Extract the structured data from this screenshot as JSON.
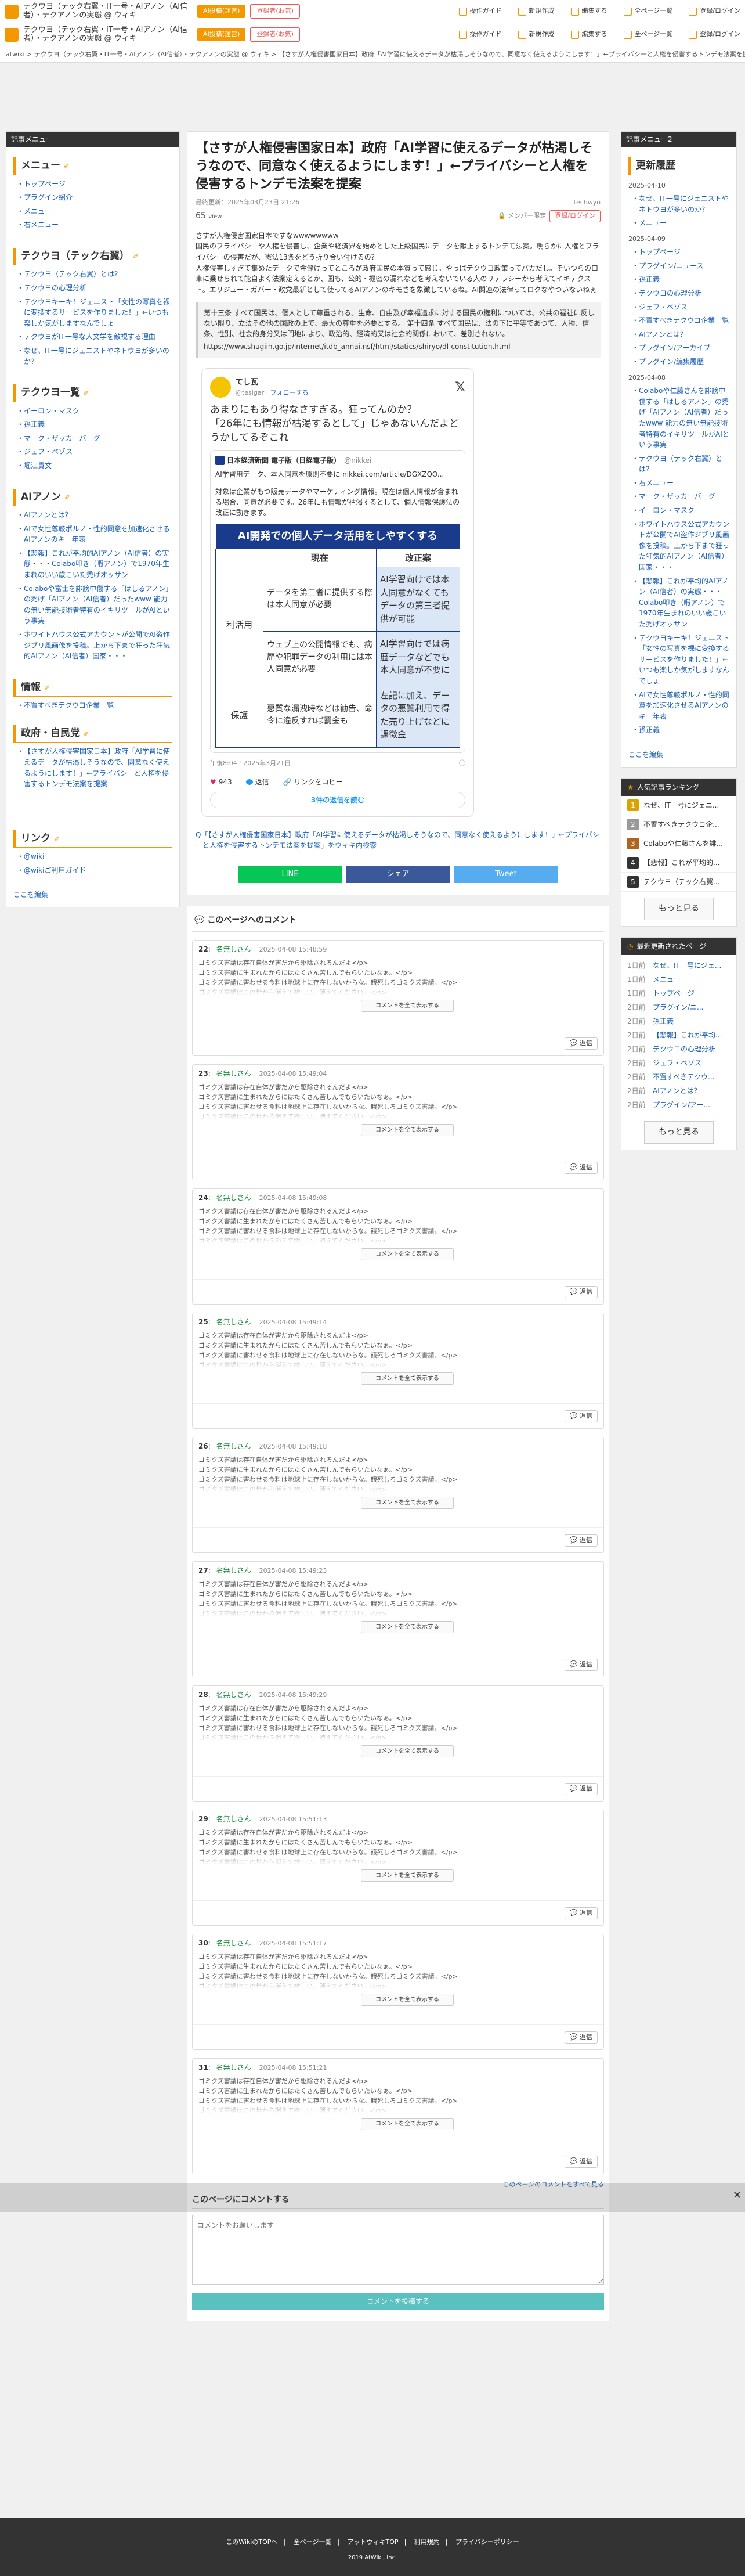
{
  "topbar": {
    "title": "テクウヨ（テック右翼・IT一号・AIアノン（AI信者）・テクアノンの実態 @ ウィキ",
    "btn_ai": "AI投稿(運営)",
    "btn_fav": "登録者(お気)",
    "nav": [
      "操作ガイド",
      "新規作成",
      "編集する",
      "全ページ一覧",
      "登録/ログイン"
    ]
  },
  "breadcrumb": "atwiki > テクウヨ（テック右翼・IT一号・AIアノン（AI信者）・テクアノンの実態 @ ウィキ > 【さすが人権侵害国家日本】政府「AI学習に使えるデータが枯渇しそうなので、同意なく使えるようにします！」←プライバシーと人権を侵害するトンデモ法案を提案",
  "left": {
    "header": "記事メニュー",
    "menu_title": "メニュー",
    "menu_items": [
      "トップページ",
      "プラグイン紹介",
      "メニュー",
      "右メニュー"
    ],
    "teku_title": "テクウヨ（テック右翼）",
    "teku_items": [
      "テクウヨ（テック右翼）とは？",
      "テクウヨの心理分析",
      "テクウヨキーキ！ジェニスト「女性の写真を裸に変換するサービスを作りました！」←いつも楽しか気がしますなんでしょ",
      "テクウヨがIT一号な人文学を敵視する理由",
      "なぜ、IT一号にジェニストやネトウヨが多いのか？"
    ],
    "list_title": "テクウヨ一覧",
    "list_items": [
      "イーロン・マスク",
      "孫正義",
      "マーク・ザッカーバーグ",
      "ジェフ・ベゾス",
      "堀江貴文"
    ],
    "anon_title": "AIアノン",
    "anon_items": [
      "AIアノンとは？",
      "AIで女性尊厳ポルノ・性的同意を加速化させるAIアノンのキー年表",
      "【悲報】これが平均的AIアノン（AI信者）の実態・・・Colabo叩き（暇アノン）で1970年生まれのいい歳こいた禿げオッサン",
      "Colaboや富士を誹謗中傷する「はしるアノン」の禿げ「AIアノン（AI信者）だったwww 能力の無い無能技術者特有のイキリツールがAIという事実",
      "ホワイトハウス公式アカウントが公開でAI盗作ジブリ風画像を投稿。上から下まで狂った狂気的AIアノン（AI信者）国家・・・"
    ],
    "info_title": "情報",
    "info_items": [
      "不置すべきテクウヨ企業一覧"
    ],
    "gov_title": "政府・自民党",
    "gov_items": [
      "【さすが人権侵害国家日本】政府「AI学習に使えるデータが枯渇しそうなので、同意なく使えるようにします！」←プライバシーと人権を侵害するトンデモ法案を提案"
    ],
    "link_title": "リンク",
    "link_items": [
      "@wiki",
      "@wikiご利用ガイド"
    ],
    "edit": "ここを編集"
  },
  "article": {
    "title": "【さすが人権侵害国家日本】政府「AI学習に使えるデータが枯渇しそうなので、同意なく使えるようにします！」←プライバシーと人権を侵害するトンデモ法案を提案",
    "updated": "最終更新：2025年03月23日 21:26",
    "author": "techwyo",
    "views": "65",
    "views_unit": "view",
    "member_label": "メンバー限定",
    "login_label": "登録/ログイン",
    "body": "さすが人権侵害国家日本ですなwwwwwwww\n国民のプライバシーや人権を侵害し、企業や経済界を始めとした上級国民にデータを献上するトンデモ法案。明らかに人権とプライバシーの侵害だが、憲法13条をどう折り合い付けるの？\n人権侵害しすぎて集めたデータで金儲けってところが政府国民の本質って感じ。やっぱテクウヨ政策ってバカだし。そいつらの口車に乗せられて能自よく法案定えるとか、国も、公的・機密の漏れなどを考えないでいる人のリテラシーから考えてイキテクスト。エリジュー・ガバー・政党最新として使ってるAIアノンのキモさを象徴しているね。AI関連の法律ってロクなやついないねぇ",
    "quote": "第十三条 すべて国民は、個人として尊重される。生命、自由及び幸福追求に対する国民の権利については、公共の福祉に反しない限り、立法その他の国政の上で、最大の尊重を必要とする。 第十四条 すべて国民は、法の下に平等であつて、人種、信条、性別、社会的身分又は門地により、政治的、経済的又は社会的関係において、差別されない。",
    "quote_link": "https://www.shugiin.go.jp/internet/itdb_annai.nsf/html/statics/shiryo/dl-constitution.html",
    "search_note": "Q「【さすが人権侵害国家日本】政府「AI学習に使えるデータが枯渇しそうなので、同意なく使えるようにします！」←プライバシーと人権を侵害するトンデモ法案を提案」をウィキ内検索"
  },
  "tweet": {
    "name": "てし瓦",
    "handle": "@tesigar",
    "follow": "フォローする",
    "text": "あまりにもあり得なさすぎる。狂ってんのか？\n「26年にも情報が枯渇するとして」じゃあないんだよどうかしてるぞこれ",
    "q_name": "日本経済新聞 電子版（日経電子版）",
    "q_handle": "@nikkei",
    "q_body": "AI学習用データ、本人同意を原則不要に nikkei.com/article/DGXZQO...",
    "q_note": "対象は企業がもつ販売データやマーケティング情報。現在は個人情報が含まれる場合、同意が必要です。26年にも情報が枯渇するとして、個人情報保護法の改正に動きます。",
    "time": "午後8:04 · 2025年3月21日",
    "likes": "943",
    "reply": "返信",
    "copy": "リンクをコピー",
    "read": "3件の返信を読む"
  },
  "gtable": {
    "title": "AI開発での個人データ活用をしやすくする",
    "col_now": "現在",
    "col_rev": "改正案",
    "cat1": "利活用",
    "cat2": "保護",
    "r1_now": "データを第三者に提供する際は本人同意が必要",
    "r1_rev": "AI学習向けでは本人同意がなくてもデータの第三者提供が可能",
    "r2_now": "ウェブ上の公開情報でも、病歴や犯罪データの利用には本人同意が必要",
    "r2_rev": "AI学習向けでは病歴データなどでも本人同意が不要に",
    "r3_now": "悪質な漏洩時などは勧告、命令に違反すれば罰金も",
    "r3_rev": "左記に加え、データの悪質利用で得た売り上げなどに課徴金"
  },
  "share": {
    "line": "LINE",
    "fb": "シェア",
    "tw": "Tweet"
  },
  "comments": {
    "title": "このページへのコメント",
    "name": "名無しさん",
    "body": "ゴミクズ害請は存在自体が害だから駆除されるんだよ</p>\nゴミクズ害請に生まれたからにはたくさん苦しんでもらいたいなぁ。</p>\nゴミクズ害請に害わせる食料は地球上に存在しないからな。餓死しろゴミクズ害請。</p>\nゴミクズ害請はこの世から消えて欲しい。消えてください。</p>",
    "more": "コメントを全て表示する",
    "reply": "返信",
    "items": [
      {
        "no": "22",
        "date": "2025-04-08 15:48:59"
      },
      {
        "no": "23",
        "date": "2025-04-08 15:49:04"
      },
      {
        "no": "24",
        "date": "2025-04-08 15:49:08"
      },
      {
        "no": "25",
        "date": "2025-04-08 15:49:14"
      },
      {
        "no": "26",
        "date": "2025-04-08 15:49:18"
      },
      {
        "no": "27",
        "date": "2025-04-08 15:49:23"
      },
      {
        "no": "28",
        "date": "2025-04-08 15:49:29"
      },
      {
        "no": "29",
        "date": "2025-04-08 15:51:13"
      },
      {
        "no": "30",
        "date": "2025-04-08 15:51:17"
      },
      {
        "no": "31",
        "date": "2025-04-08 15:51:21"
      }
    ],
    "all_link": "このページのコメントをすべて見る",
    "post_title": "このページにコメントする",
    "post_placeholder": "コメントをお願いします",
    "post_btn": "コメントを投稿する"
  },
  "right": {
    "header": "記事メニュー2",
    "upd_title": "更新履歴",
    "d1": "2025-04-10",
    "d1_items": [
      "なぜ、IT一号にジェニストやネトウヨが多いのか？",
      "メニュー"
    ],
    "d2": "2025-04-09",
    "d2_items": [
      "トップページ",
      "プラグイン/ニュース",
      "孫正義",
      "テクウヨの心理分析",
      "ジェフ・ベゾス",
      "不置すべきテクウヨ企業一覧",
      "AIアノンとは？",
      "プラグイン/アーカイブ",
      "プラグイン/編集履歴"
    ],
    "d3": "2025-04-08",
    "d3_items": [
      "Colaboや仁藤さんを誹謗中傷する「はしるアノン」の禿げ「AIアノン（AI信者）だったwww 能力の無い無能技術者特有のイキリツールがAIという事実",
      "テクウヨ（テック右翼）とは？",
      "右メニュー",
      "マーク・ザッカーバーグ",
      "イーロン・マスク",
      "ホワイトハウス公式アカウントが公開でAI盗作ジブリ風画像を投稿。上から下まで狂った狂気的AIアノン（AI信者）国家・・・",
      "【悲報】これが平均的AIアノン（AI信者）の実態・・・Colabo叩き（暇アノン）で1970年生まれのいい歳こいた禿げオッサン",
      "テクウヨキーキ！ジェニスト「女性の写真を裸に変換するサービスを作りました！」←いつも楽しか気がしますなんでしょ",
      "AIで女性尊厳ポルノ・性的同意を加速化させるAIアノンのキー年表",
      "孫正義"
    ],
    "edit": "ここを編集",
    "rank_title": "人気記事ランキング",
    "rank_items": [
      "なぜ、IT一号にジェニ...",
      "不置すべきテクウヨ企...",
      "Colaboや仁藤さんを誹...",
      "【悲報】これが平均的...",
      "テクウヨ（テック右翼..."
    ],
    "rank_colors": [
      "#d9a300",
      "#999999",
      "#b0651e",
      "#333333",
      "#333333"
    ],
    "more": "もっと見る",
    "recent_title": "最近更新されたページ",
    "recent": [
      {
        "d": "1日前",
        "l": "なぜ、IT一号にジェ..."
      },
      {
        "d": "1日前",
        "l": "メニュー"
      },
      {
        "d": "1日前",
        "l": "トップページ"
      },
      {
        "d": "2日前",
        "l": "プラグイン/ニ..."
      },
      {
        "d": "2日前",
        "l": "孫正義"
      },
      {
        "d": "2日前",
        "l": "【悲報】これが平均..."
      },
      {
        "d": "2日前",
        "l": "テクウヨの心理分析"
      },
      {
        "d": "2日前",
        "l": "ジェフ・ベゾス"
      },
      {
        "d": "2日前",
        "l": "不置すべきテクウ..."
      },
      {
        "d": "2日前",
        "l": "AIアノンとは？"
      },
      {
        "d": "2日前",
        "l": "プラグイン/アー..."
      }
    ],
    "recent_more": "もっと見る"
  },
  "footer": {
    "links": [
      "このWikiのTOPへ",
      "全ページ一覧",
      "アットウィキTOP",
      "利用規約",
      "プライバシーポリシー"
    ],
    "copy": "2019 AtWiki, Inc."
  }
}
